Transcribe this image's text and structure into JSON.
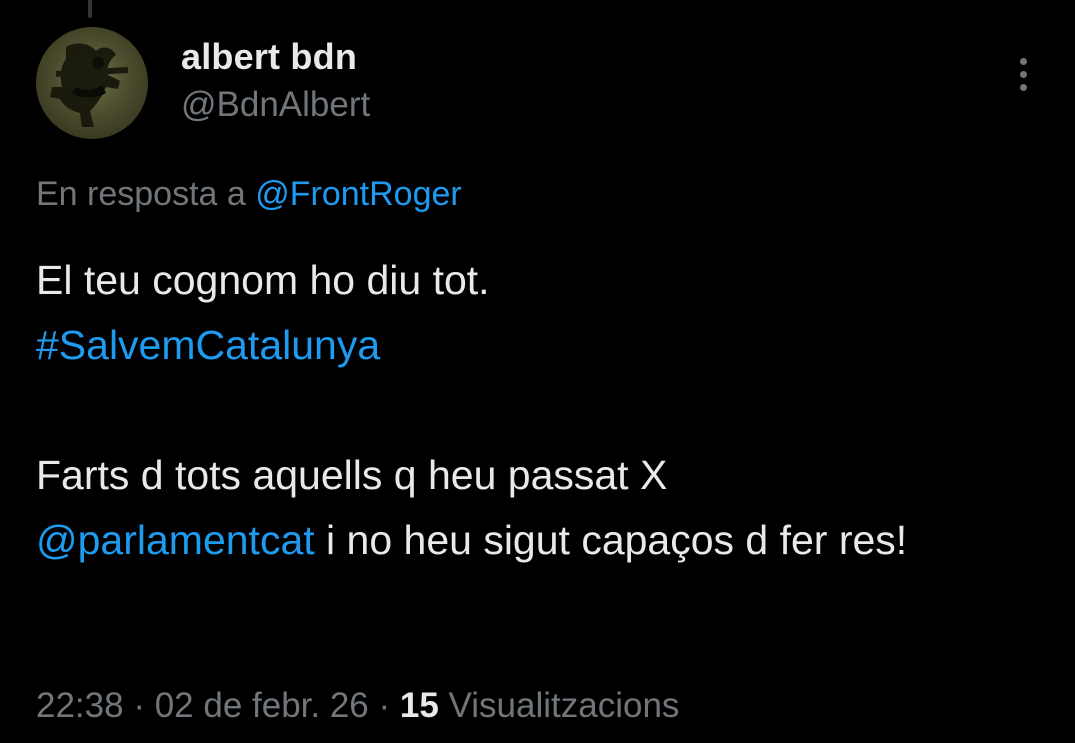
{
  "tweet": {
    "author": {
      "display_name": "albert bdn",
      "handle": "@BdnAlbert",
      "avatar_icon": "avatar-image"
    },
    "more_icon": "more-vertical-icon",
    "reply": {
      "prefix": "En resposta a",
      "mention": "@FrontRoger"
    },
    "text": {
      "line1": "El teu cognom ho diu tot.",
      "hashtag": "#SalvemCatalunya",
      "line3_start": "Farts d tots aquells q heu passat X",
      "mention": "@parlamentcat",
      "line3_end": " i no heu sigut capaços d fer res!"
    },
    "meta": {
      "time": "22:38",
      "separator1": " · ",
      "date": "02 de febr. 26",
      "separator2": " · ",
      "views_count": "15",
      "views_label": " Visualitzacions"
    }
  },
  "colors": {
    "background": "#000000",
    "text": "#e7e9ea",
    "secondary": "#71767b",
    "link": "#1d9bf0"
  }
}
